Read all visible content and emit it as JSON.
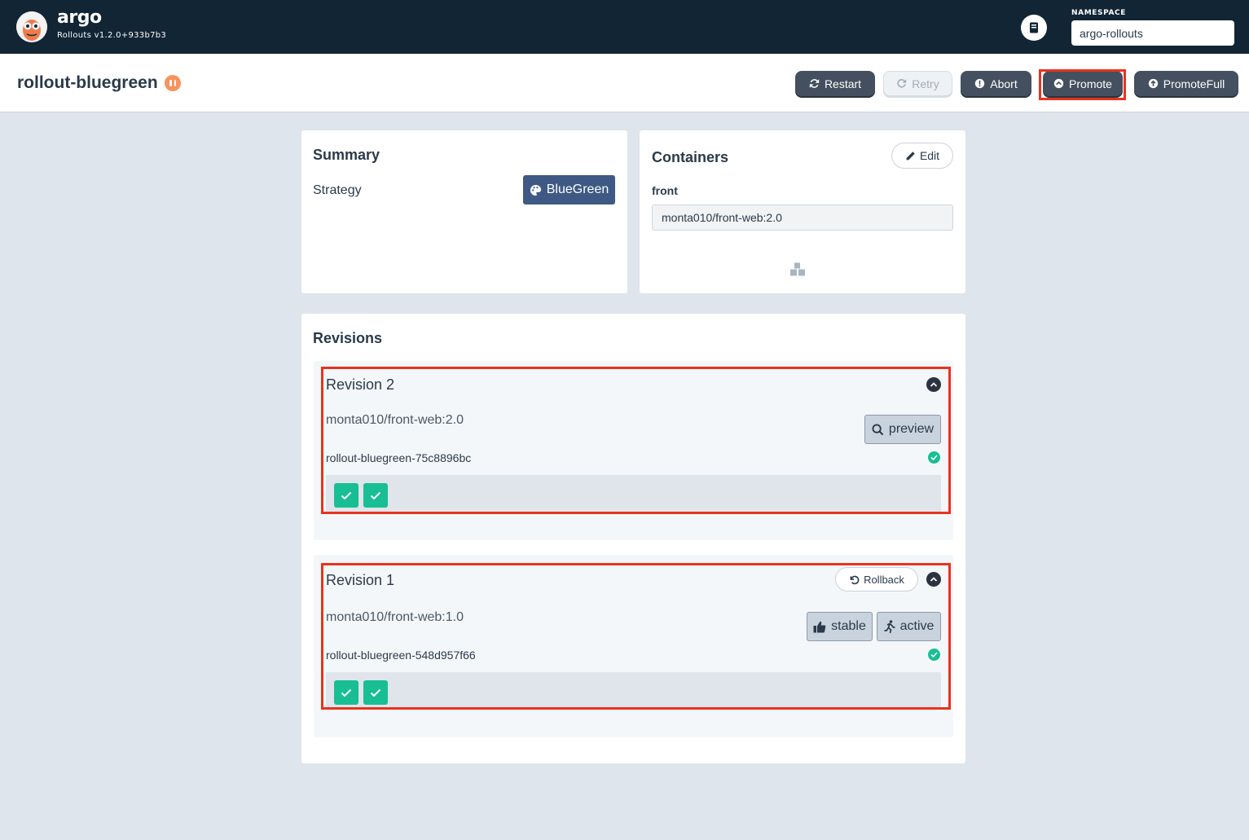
{
  "nav": {
    "brand": "argo",
    "version": "Rollouts v1.2.0+933b7b3",
    "logo_icon": "argo-logo-icon",
    "docs_icon": "book-icon",
    "namespace_label": "NAMESPACE",
    "namespace_value": "argo-rollouts"
  },
  "header": {
    "rollout_name": "rollout-bluegreen",
    "status_icon": "paused-icon",
    "status_color": "#f7935e",
    "actions": {
      "restart": "Restart",
      "retry": "Retry",
      "abort": "Abort",
      "promote": "Promote",
      "promote_full": "PromoteFull"
    }
  },
  "summary": {
    "title": "Summary",
    "strategy_label": "Strategy",
    "strategy_value": "BlueGreen",
    "strategy_icon": "palette-icon"
  },
  "containers": {
    "title": "Containers",
    "edit_label": "Edit",
    "items": [
      {
        "name": "front",
        "image": "monta010/front-web:2.0"
      }
    ]
  },
  "revisions": {
    "title": "Revisions",
    "items": [
      {
        "title": "Revision 2",
        "image": "monta010/front-web:2.0",
        "replicaset": "rollout-bluegreen-75c8896bc",
        "tags": [
          "preview"
        ],
        "pods": [
          "ok",
          "ok"
        ]
      },
      {
        "title": "Revision 1",
        "rollback_label": "Rollback",
        "image": "monta010/front-web:1.0",
        "replicaset": "rollout-bluegreen-548d957f66",
        "tags": [
          "stable",
          "active"
        ],
        "pods": [
          "ok",
          "ok"
        ]
      }
    ]
  },
  "colors": {
    "nav_bg": "#112535",
    "page_bg": "#dee5ec",
    "button_dark": "#44505f",
    "strategy_blue": "#3e5a84",
    "healthy_green": "#18be94",
    "highlight_red": "#e8331e"
  }
}
